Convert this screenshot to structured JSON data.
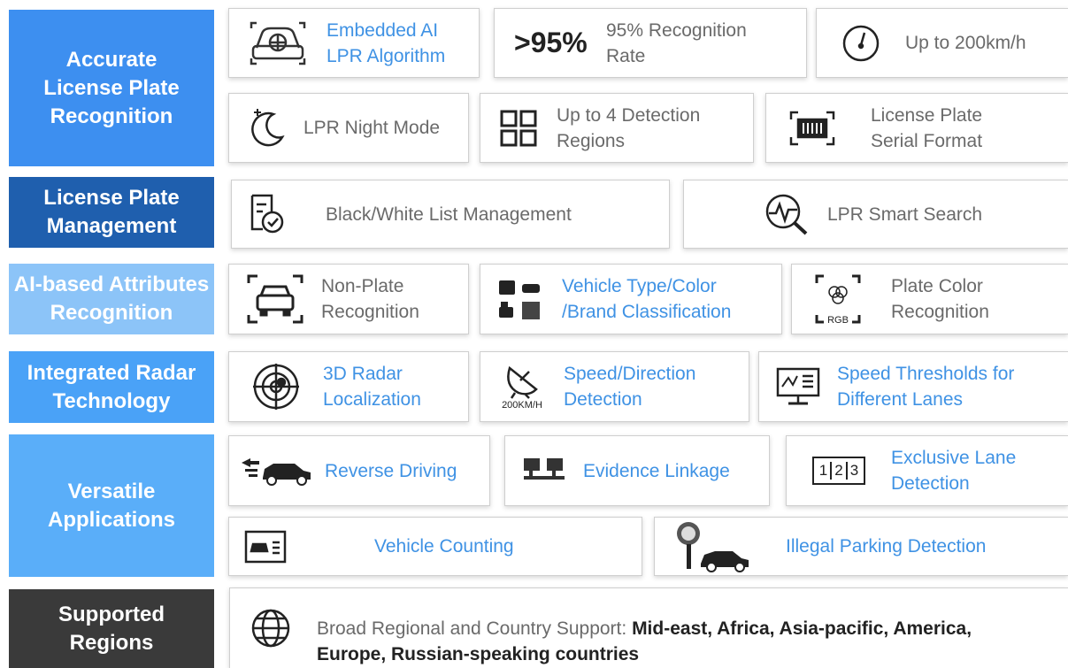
{
  "categories": {
    "accurate_lpr": {
      "label": "Accurate\nLicense Plate\nRecognition",
      "color": "#3d8ff0"
    },
    "lp_management": {
      "label": "License Plate\nManagement",
      "color": "#1f5fae"
    },
    "ai_attributes": {
      "label": "AI-based Attributes\nRecognition",
      "color": "#8cc4f8"
    },
    "radar": {
      "label": "Integrated Radar\nTechnology",
      "color": "#4aa2f7"
    },
    "versatile": {
      "label": "Versatile\nApplications",
      "color": "#5aaef9"
    },
    "regions": {
      "label": "Supported\nRegions",
      "color": "#3a3a3a"
    }
  },
  "features": {
    "embedded_ai": "Embedded AI\nLPR Algorithm",
    "recognition_big": ">95%",
    "recognition_rate": "95% Recognition\nRate",
    "speed": "Up to 200km/h",
    "night_mode": "LPR Night Mode",
    "detection_regions": "Up to 4  Detection\nRegions",
    "serial_format": "License Plate\nSerial Format",
    "bw_list": "Black/White List Management",
    "smart_search": "LPR Smart Search",
    "non_plate": "Non-Plate\nRecognition",
    "vehicle_type": "Vehicle Type/Color\n/Brand Classification",
    "plate_color": "Plate Color\nRecognition",
    "rgb_text": "RGB",
    "radar_3d": "3D Radar\nLocalization",
    "speed_direction": "Speed/Direction\nDetection",
    "speed_badge": "200KM/H",
    "speed_thresholds": "Speed Thresholds for\nDifferent Lanes",
    "reverse_driving": "Reverse Driving",
    "evidence_linkage": "Evidence Linkage",
    "exclusive_lane": "Exclusive Lane\nDetection",
    "lane_numbers": [
      "1",
      "2",
      "3"
    ],
    "vehicle_counting": "Vehicle Counting",
    "illegal_parking": "Illegal Parking Detection",
    "regions_prefix": "Broad Regional and Country Support: ",
    "regions_list": "Mid-east, Africa, Asia-pacific, America,",
    "regions_list_2": "Europe, Russian-speaking countries"
  },
  "colors": {
    "accent_text": "#3f92e4",
    "muted_text": "#6a6a6a",
    "border": "#cfcfcf"
  },
  "icons": [
    "car-head-icon",
    "speedometer-icon",
    "moon-icon",
    "grid-icon",
    "barcode-icon",
    "document-check-icon",
    "search-pulse-icon",
    "car-scan-icon",
    "vehicle-types-icon",
    "rgb-scan-icon",
    "radar-icon",
    "satellite-dish-icon",
    "monitor-chart-icon",
    "reverse-car-icon",
    "linked-devices-icon",
    "lane-icon",
    "counting-card-icon",
    "parking-sign-icon",
    "globe-icon"
  ]
}
